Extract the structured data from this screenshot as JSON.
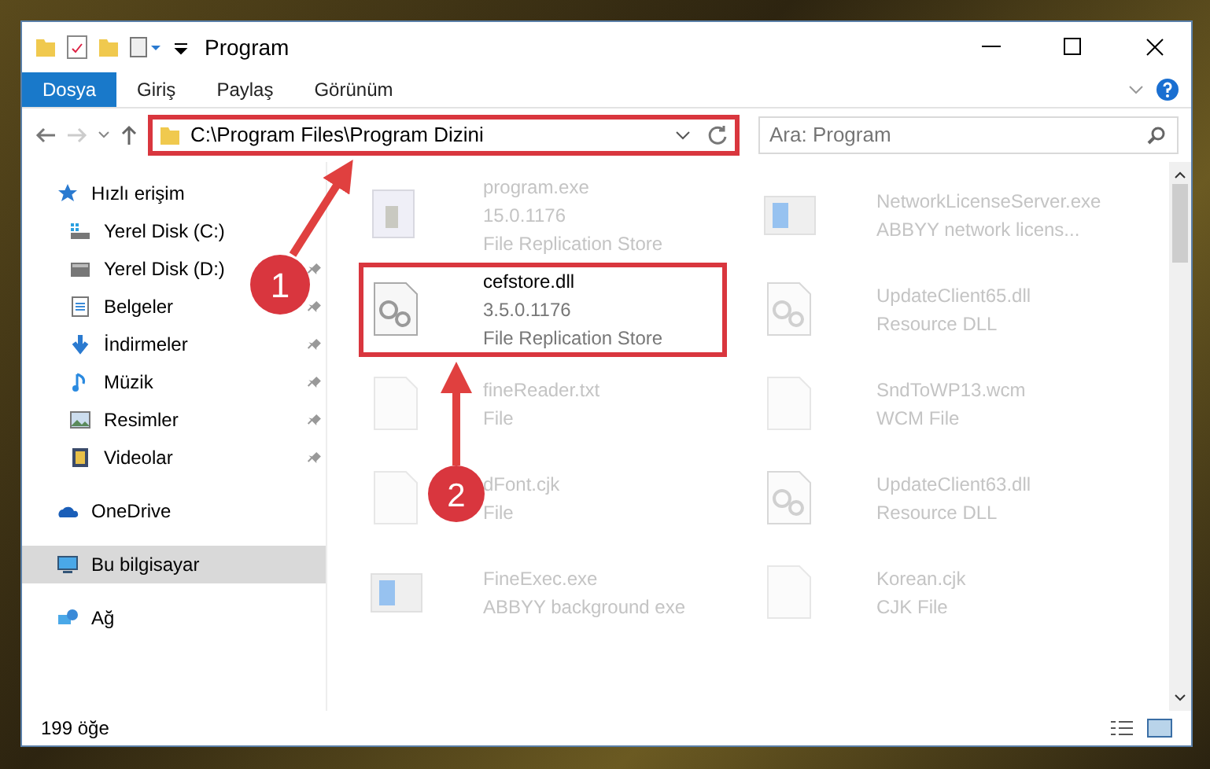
{
  "window": {
    "title": "Program"
  },
  "ribbon_tabs": [
    {
      "label": "Dosya",
      "selected": true
    },
    {
      "label": "Giriş",
      "selected": false
    },
    {
      "label": "Paylaş",
      "selected": false
    },
    {
      "label": "Görünüm",
      "selected": false
    }
  ],
  "address": {
    "path": "C:\\Program Files\\Program Dizini",
    "highlighted": true
  },
  "search": {
    "placeholder": "Ara: Program"
  },
  "nav": {
    "items": [
      {
        "label": "Hızlı erişim",
        "kind": "star",
        "selected": false,
        "children": [
          {
            "label": "Yerel Disk (C:)",
            "kind": "drive-c",
            "pinned": false
          },
          {
            "label": "Yerel Disk (D:)",
            "kind": "drive",
            "pinned": true
          },
          {
            "label": "Belgeler",
            "kind": "docs",
            "pinned": true
          },
          {
            "label": "İndirmeler",
            "kind": "download",
            "pinned": true
          },
          {
            "label": "Müzik",
            "kind": "music",
            "pinned": true
          },
          {
            "label": "Resimler",
            "kind": "pictures",
            "pinned": true
          },
          {
            "label": "Videolar",
            "kind": "videos",
            "pinned": true
          }
        ]
      },
      {
        "label": "OneDrive",
        "kind": "cloud",
        "selected": false
      },
      {
        "label": "Bu bilgisayar",
        "kind": "pc",
        "selected": true
      },
      {
        "label": "Ağ",
        "kind": "network",
        "selected": false
      }
    ]
  },
  "files": [
    {
      "name": "program.exe",
      "details": [
        "15.0.1176",
        "File Replication Store"
      ],
      "kind": "setup",
      "highlighted": false,
      "faded": true
    },
    {
      "name": "NetworkLicenseServer.exe",
      "details": [
        "ABBYY network licens..."
      ],
      "kind": "app",
      "highlighted": false,
      "faded": true
    },
    {
      "name": "cefstore.dll",
      "details": [
        "3.5.0.1176",
        "File Replication Store"
      ],
      "kind": "dll",
      "highlighted": true,
      "faded": false
    },
    {
      "name": "UpdateClient65.dll",
      "details": [
        "Resource DLL"
      ],
      "kind": "dll",
      "highlighted": false,
      "faded": true
    },
    {
      "name": "fineReader.txt",
      "details": [
        "File"
      ],
      "kind": "file",
      "highlighted": false,
      "faded": true
    },
    {
      "name": "SndToWP13.wcm",
      "details": [
        "WCM File"
      ],
      "kind": "file",
      "highlighted": false,
      "faded": true
    },
    {
      "name": "dFont.cjk",
      "details": [
        "File"
      ],
      "kind": "file",
      "highlighted": false,
      "faded": true
    },
    {
      "name": "UpdateClient63.dll",
      "details": [
        "Resource DLL"
      ],
      "kind": "dll",
      "highlighted": false,
      "faded": true
    },
    {
      "name": "FineExec.exe",
      "details": [
        "ABBYY background exe"
      ],
      "kind": "app",
      "highlighted": false,
      "faded": true
    },
    {
      "name": "Korean.cjk",
      "details": [
        "CJK File"
      ],
      "kind": "file",
      "highlighted": false,
      "faded": true
    }
  ],
  "status_bar": {
    "count": "199 öğe"
  },
  "annotations": [
    {
      "label": "1"
    },
    {
      "label": "2"
    }
  ]
}
